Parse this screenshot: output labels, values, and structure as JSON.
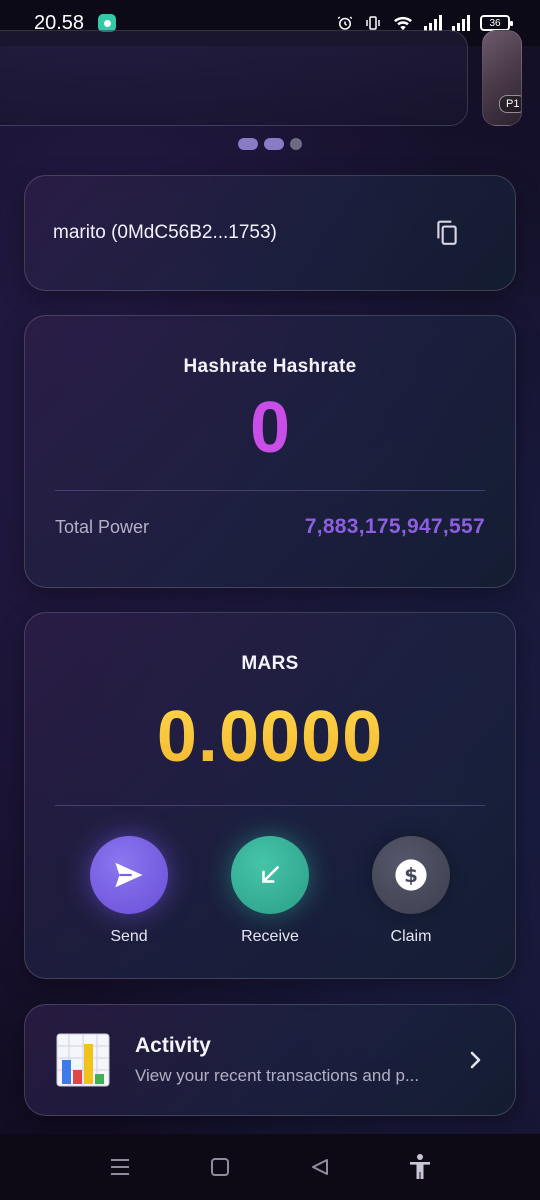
{
  "status_bar": {
    "time": "20.58",
    "battery": "36"
  },
  "carousel": {
    "next_card_label": "P1",
    "dots": 3,
    "active_index": 1
  },
  "wallet": {
    "name": "marito (0MdC56B2...1753)",
    "copy_icon": "copy-icon"
  },
  "hashrate": {
    "title": "Hashrate Hashrate",
    "value": "0",
    "total_power_label": "Total Power",
    "total_power_value": "7,883,175,947,557"
  },
  "mars": {
    "title": "MARS",
    "balance": "0.0000",
    "actions": [
      {
        "label": "Send",
        "icon": "send-icon"
      },
      {
        "label": "Receive",
        "icon": "receive-arrow-icon"
      },
      {
        "label": "Claim",
        "icon": "dollar-icon"
      }
    ]
  },
  "activity": {
    "title": "Activity",
    "subtitle": "View your recent transactions and p..."
  },
  "colors": {
    "hashrate_value": "#c94ee8",
    "power_value": "#8d5ee0",
    "mars_balance": "#ffd54a",
    "send": "#7a62e6",
    "receive": "#38b298",
    "claim": "#4a4c5e"
  }
}
